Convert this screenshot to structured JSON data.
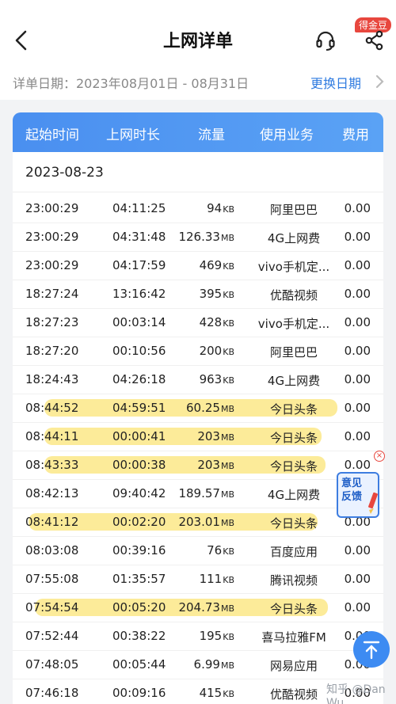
{
  "header": {
    "title": "上网详单",
    "badge": "得金豆"
  },
  "date_bar": {
    "label": "详单日期：2023年08月01日 - 08月31日",
    "change_label": "更换日期"
  },
  "table": {
    "columns": [
      "起始时间",
      "上网时长",
      "流量",
      "使用业务",
      "费用"
    ],
    "date_group": "2023-08-23",
    "rows": [
      {
        "time": "23:00:29",
        "duration": "04:11:25",
        "amount": "94",
        "unit": "KB",
        "service": "阿里巴巴",
        "fee": "0.00"
      },
      {
        "time": "23:00:29",
        "duration": "04:31:48",
        "amount": "126.33",
        "unit": "MB",
        "service": "4G上网费",
        "fee": "0.00"
      },
      {
        "time": "23:00:29",
        "duration": "04:17:59",
        "amount": "469",
        "unit": "KB",
        "service": "vivo手机定...",
        "fee": "0.00"
      },
      {
        "time": "18:27:24",
        "duration": "13:16:42",
        "amount": "395",
        "unit": "KB",
        "service": "优酷视频",
        "fee": "0.00"
      },
      {
        "time": "18:27:23",
        "duration": "00:03:14",
        "amount": "428",
        "unit": "KB",
        "service": "vivo手机定...",
        "fee": "0.00"
      },
      {
        "time": "18:27:20",
        "duration": "00:10:56",
        "amount": "200",
        "unit": "KB",
        "service": "阿里巴巴",
        "fee": "0.00"
      },
      {
        "time": "18:24:43",
        "duration": "04:26:18",
        "amount": "963",
        "unit": "KB",
        "service": "4G上网费",
        "fee": "0.00"
      },
      {
        "time": "08:44:52",
        "duration": "04:59:51",
        "amount": "60.25",
        "unit": "MB",
        "service": "今日头条",
        "fee": "0.00"
      },
      {
        "time": "08:44:11",
        "duration": "00:00:41",
        "amount": "203",
        "unit": "MB",
        "service": "今日头条",
        "fee": "0.00"
      },
      {
        "time": "08:43:33",
        "duration": "00:00:38",
        "amount": "203",
        "unit": "MB",
        "service": "今日头条",
        "fee": "0.00"
      },
      {
        "time": "08:42:13",
        "duration": "09:40:42",
        "amount": "189.57",
        "unit": "MB",
        "service": "4G上网费",
        "fee": "0.00"
      },
      {
        "time": "08:41:12",
        "duration": "00:02:20",
        "amount": "203.01",
        "unit": "MB",
        "service": "今日头条",
        "fee": "0.00"
      },
      {
        "time": "08:03:08",
        "duration": "00:39:16",
        "amount": "76",
        "unit": "KB",
        "service": "百度应用",
        "fee": "0.00"
      },
      {
        "time": "07:55:08",
        "duration": "01:35:57",
        "amount": "111",
        "unit": "KB",
        "service": "腾讯视频",
        "fee": "0.00"
      },
      {
        "time": "07:54:54",
        "duration": "00:05:20",
        "amount": "204.73",
        "unit": "MB",
        "service": "今日头条",
        "fee": "0.00"
      },
      {
        "time": "07:52:44",
        "duration": "00:38:22",
        "amount": "195",
        "unit": "KB",
        "service": "喜马拉雅FM",
        "fee": "0.00"
      },
      {
        "time": "07:48:05",
        "duration": "00:05:44",
        "amount": "6.99",
        "unit": "MB",
        "service": "网易应用",
        "fee": "0.00"
      },
      {
        "time": "07:46:18",
        "duration": "00:09:16",
        "amount": "415",
        "unit": "KB",
        "service": "优酷视频",
        "fee": "0.00"
      }
    ]
  },
  "feedback": {
    "label": "意见反馈"
  },
  "watermark": "知乎 @Dan Wu",
  "colors": {
    "accent": "#2f7be0",
    "header_gradient": "#4a8ff0",
    "badge": "#e8473e",
    "highlight": "#fade5a"
  },
  "icons": {
    "back": "chevron-left-icon",
    "support": "headset-icon",
    "share": "share-icon",
    "top": "arrow-up-icon"
  }
}
